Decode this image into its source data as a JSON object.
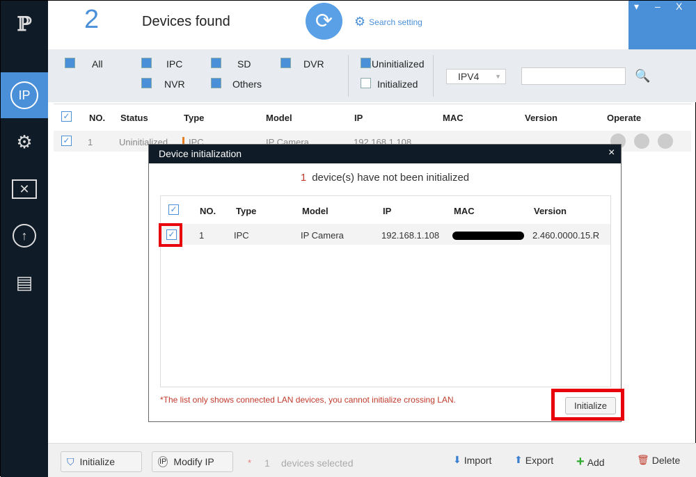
{
  "app": {
    "logo": "IP-logo",
    "count": "2",
    "title": "Devices found",
    "search_setting": "Search setting",
    "window_buttons": [
      "▾",
      "–",
      "X"
    ]
  },
  "sidebar": {
    "items": [
      {
        "icon": "ip-icon"
      },
      {
        "icon": "camera-settings-icon"
      },
      {
        "icon": "tools-icon"
      },
      {
        "icon": "upgrade-icon"
      },
      {
        "icon": "document-list-icon"
      }
    ]
  },
  "filters": {
    "all": "All",
    "ipc": "IPC",
    "sd": "SD",
    "dvr": "DVR",
    "nvr": "NVR",
    "others": "Others",
    "uninitialized": "Uninitialized",
    "initialized": "Initialized",
    "ip_version": "IPV4",
    "search_value": ""
  },
  "table": {
    "headers": [
      "NO.",
      "Status",
      "Type",
      "Model",
      "IP",
      "MAC",
      "Version",
      "Operate"
    ],
    "rows": [
      {
        "no": "1",
        "status": "Uninitialized",
        "type": "IPC",
        "model": "IP Camera",
        "ip": "192.168.1.108"
      }
    ]
  },
  "dialog": {
    "title": "Device initialization",
    "close": "×",
    "count": "1",
    "message": "device(s) have not been initialized",
    "headers": [
      "NO.",
      "Type",
      "Model",
      "IP",
      "MAC",
      "Version"
    ],
    "rows": [
      {
        "no": "1",
        "type": "IPC",
        "model": "IP Camera",
        "ip": "192.168.1.108",
        "mac": "",
        "version": "2.460.0000.15.R"
      }
    ],
    "note": "*The list only shows connected LAN devices, you cannot initialize crossing LAN.",
    "initialize": "Initialize",
    "highlight_color": "#e8000b"
  },
  "bottom": {
    "initialize": "Initialize",
    "modify_ip": "Modify IP",
    "star": "*",
    "selected_count": "1",
    "selected_label": "devices selected",
    "import": "Import",
    "export": "Export",
    "add": "Add",
    "delete": "Delete"
  },
  "colors": {
    "accent": "#4a90d9",
    "sidebar": "#0f1b27",
    "warning": "#c0392b"
  }
}
